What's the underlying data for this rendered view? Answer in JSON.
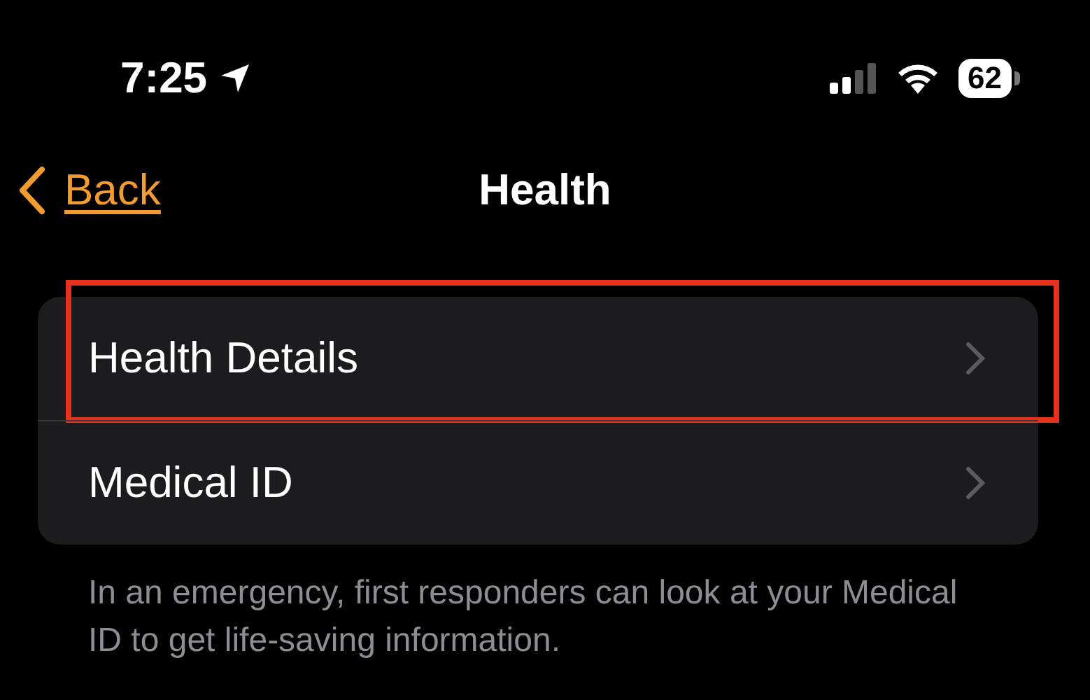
{
  "status_bar": {
    "time": "7:25",
    "battery": "62"
  },
  "nav": {
    "back": "Back",
    "title": "Health"
  },
  "rows": [
    {
      "label": "Health Details",
      "highlighted": true
    },
    {
      "label": "Medical ID",
      "highlighted": false
    }
  ],
  "footer": "In an emergency, first responders can look at your Medical ID to get life-saving information."
}
